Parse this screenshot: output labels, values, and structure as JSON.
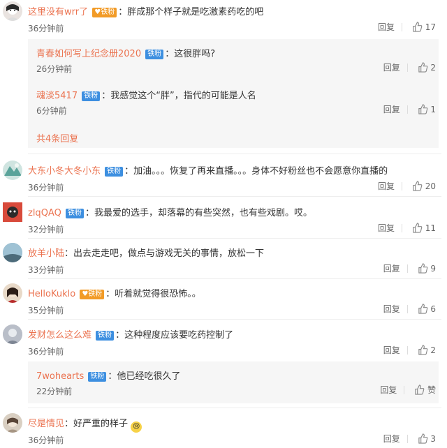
{
  "comments": [
    {
      "name": "这里没有wrr了",
      "badge": "铁粉",
      "text": "胖成那个样子就是吃激素药吃的吧",
      "time": "36分钟前",
      "reply_label": "回复",
      "likes": "17",
      "replies": [
        {
          "name": "青春如何写上纪念册2020",
          "badge": "铁粉",
          "text": "这很胖吗?",
          "time": "26分钟前",
          "reply_label": "回复",
          "likes": "2"
        },
        {
          "name": "魂淡5417",
          "badge": "铁粉",
          "text": "我感觉这个“胖”，指代的可能是人名",
          "time": "6分钟前",
          "reply_label": "回复",
          "likes": "1"
        }
      ],
      "more_replies": "共4条回复"
    },
    {
      "name": "大东小冬大冬小东",
      "badge": "铁粉",
      "text": "加油。。。恢复了再来直播。。。身体不好粉丝也不会愿意你直播的",
      "time": "36分钟前",
      "reply_label": "回复",
      "likes": "20"
    },
    {
      "name": "zlqQAQ",
      "badge": "铁粉",
      "text": "我最爱的选手，却落幕的有些突然，也有些戏剧。哎。",
      "time": "32分钟前",
      "reply_label": "回复",
      "likes": "11"
    },
    {
      "name": "放羊小陆",
      "text": "出去走走吧，做点与游戏无关的事情，放松一下",
      "time": "33分钟前",
      "reply_label": "回复",
      "likes": "9"
    },
    {
      "name": "HelloKuklo",
      "badge": "铁粉",
      "text": "听着就觉得很恐怖。。",
      "time": "35分钟前",
      "reply_label": "回复",
      "likes": "6"
    },
    {
      "name": "发财怎么这么难",
      "badge": "铁粉",
      "text": "这种程度应该要吃药控制了",
      "time": "36分钟前",
      "reply_label": "回复",
      "likes": "2",
      "replies": [
        {
          "name": "7wohearts",
          "badge": "铁粉",
          "text": "他已经吃很久了",
          "time": "22分钟前",
          "reply_label": "回复",
          "likes": "赞"
        }
      ]
    },
    {
      "name": "尽是情见",
      "text": "好严重的样子",
      "time": "36分钟前",
      "reply_label": "回复",
      "likes": "3"
    }
  ],
  "colors": {
    "username": "#eb7350",
    "badge": "#3d8fe0",
    "reply_bg": "#f6f6f6"
  },
  "icons": {
    "like": "thumbs-up-icon",
    "emoji": "crying-face-emoji"
  }
}
